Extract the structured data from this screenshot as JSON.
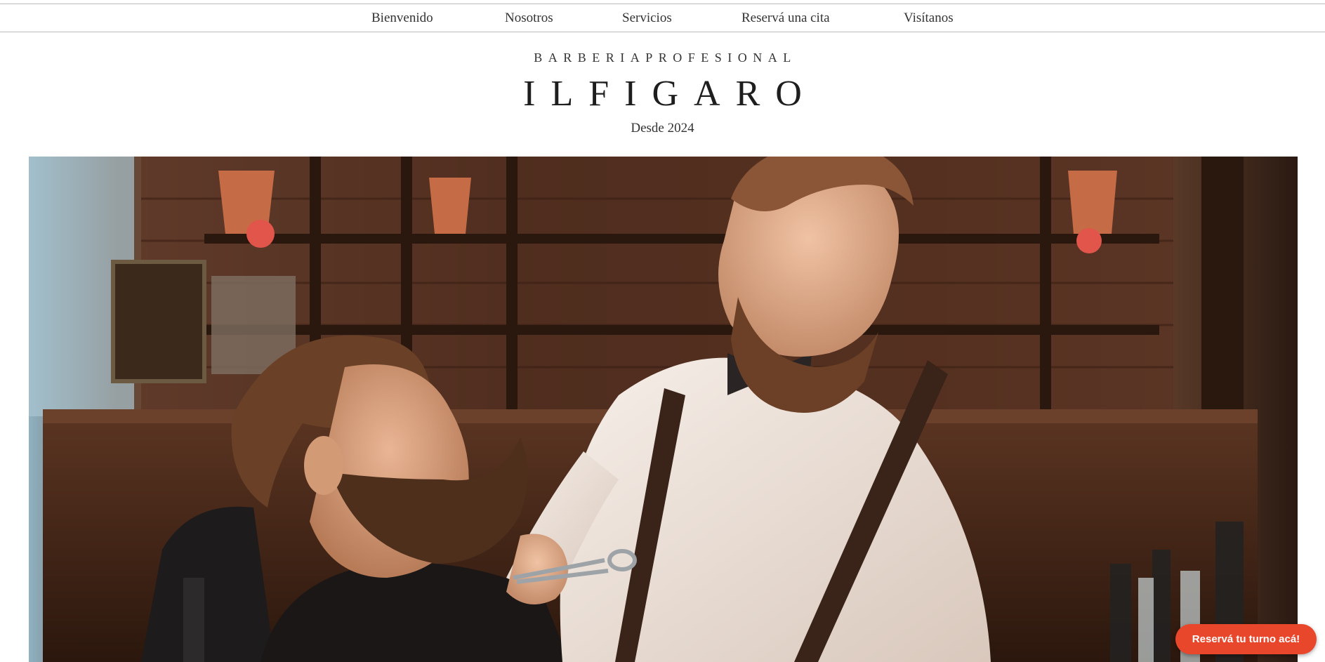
{
  "nav": {
    "items": [
      {
        "label": "Bienvenido"
      },
      {
        "label": "Nosotros"
      },
      {
        "label": "Servicios"
      },
      {
        "label": "Reservá una cita"
      },
      {
        "label": "Visítanos"
      }
    ]
  },
  "header": {
    "tagline": "BARBERIAPROFESIONAL",
    "name": "ILFIGARO",
    "since": "Desde 2024"
  },
  "cta": {
    "label": "Reservá tu turno acá!"
  },
  "colors": {
    "accent": "#e9472b",
    "text": "#222222",
    "divider": "#bdbdbd"
  }
}
